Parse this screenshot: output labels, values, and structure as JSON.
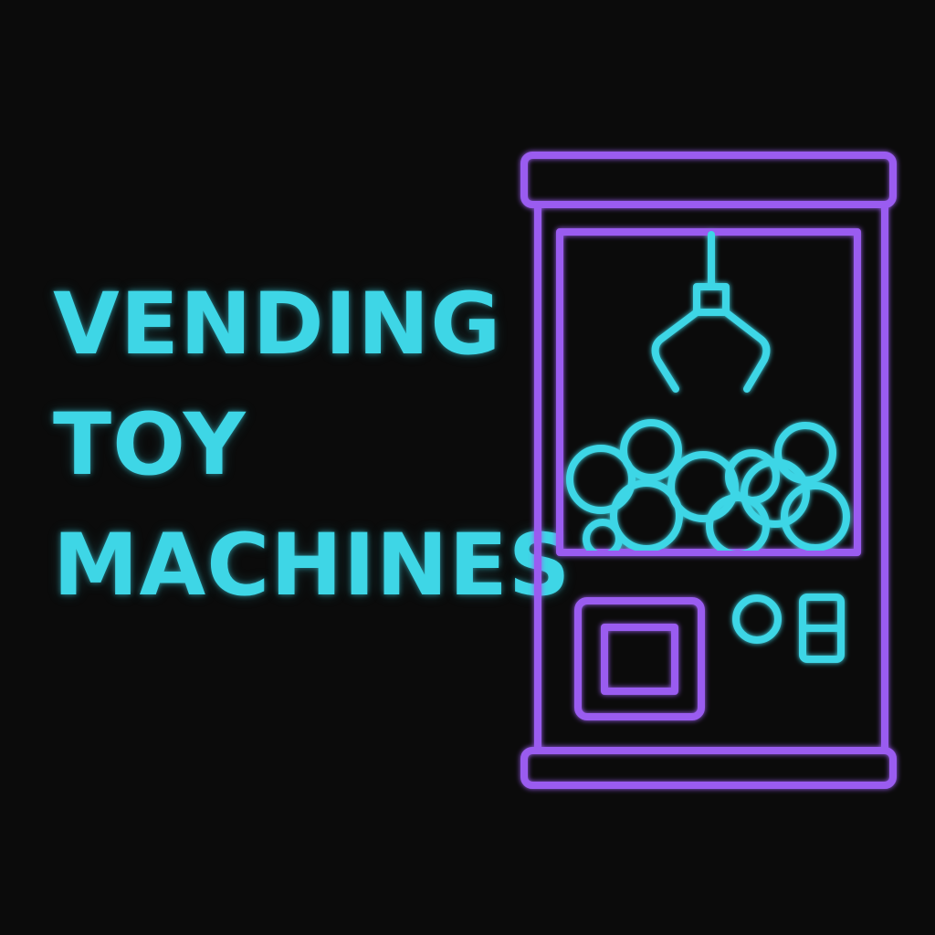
{
  "headline": {
    "lines": [
      "VENDING",
      "TOY",
      "MACHINES"
    ]
  },
  "icon": {
    "name": "claw-machine-icon",
    "colors": {
      "frame": "#9a5cf0",
      "accent": "#3ed6e6",
      "background": "#0b0b0b"
    }
  }
}
